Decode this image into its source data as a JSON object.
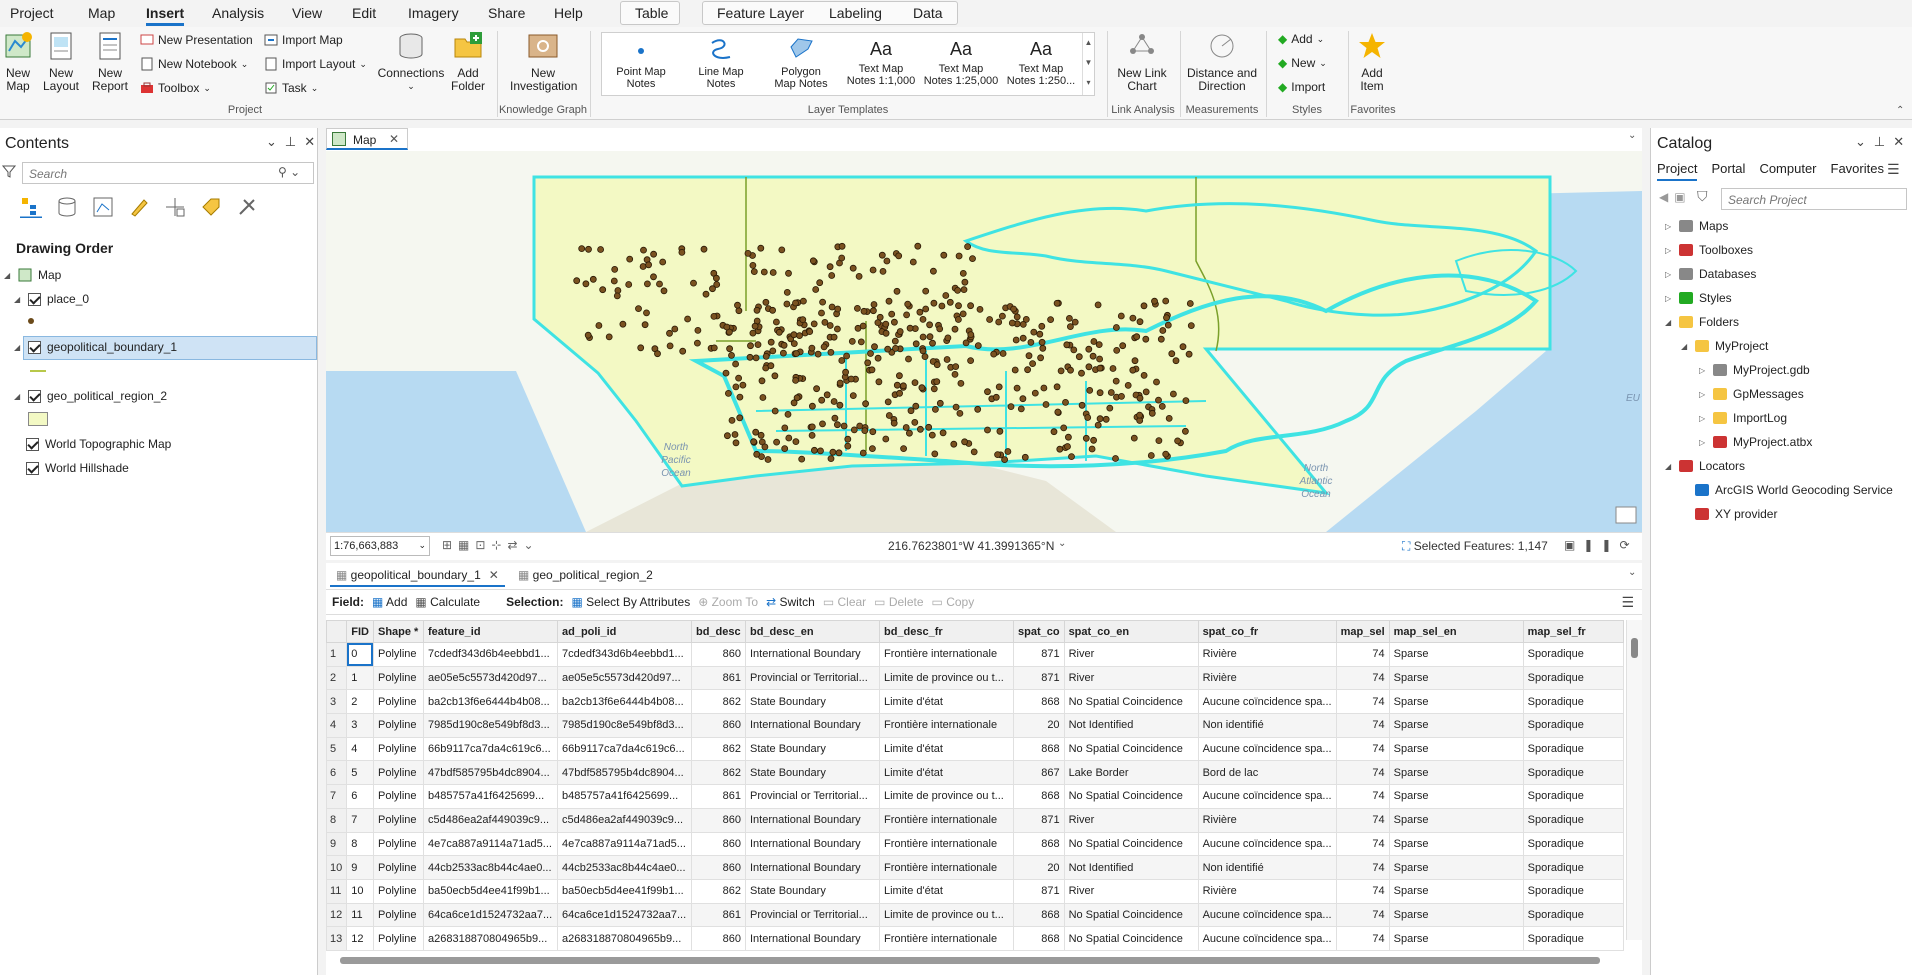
{
  "menu": {
    "tabs": [
      "Project",
      "Map",
      "Insert",
      "Analysis",
      "View",
      "Edit",
      "Imagery",
      "Share",
      "Help"
    ],
    "active": "Insert",
    "context_tabs": [
      "Table",
      "Feature Layer",
      "Labeling",
      "Data"
    ]
  },
  "ribbon": {
    "new_map": "New Map",
    "new_layout": "New Layout",
    "new_report": "New Report",
    "new_presentation": "New Presentation",
    "new_notebook": "New Notebook",
    "toolbox": "Toolbox",
    "import_map": "Import Map",
    "import_layout": "Import Layout",
    "task": "Task",
    "connections": "Connections",
    "add_folder": "Add Folder",
    "group_project": "Project",
    "new_investigation": "New Investigation",
    "group_kg": "Knowledge Graph",
    "templates": [
      {
        "l1": "Point Map",
        "l2": "Notes"
      },
      {
        "l1": "Line Map",
        "l2": "Notes"
      },
      {
        "l1": "Polygon",
        "l2": "Map Notes"
      },
      {
        "l1": "Text Map",
        "l2": "Notes 1:1,000"
      },
      {
        "l1": "Text Map",
        "l2": "Notes 1:25,000"
      },
      {
        "l1": "Text Map",
        "l2": "Notes 1:250..."
      }
    ],
    "group_templates": "Layer Templates",
    "new_link_chart": "New Link Chart",
    "group_link": "Link Analysis",
    "distance_direction": "Distance and Direction",
    "group_measure": "Measurements",
    "styles_add": "Add",
    "styles_new": "New",
    "styles_import": "Import",
    "group_styles": "Styles",
    "add_item": "Add Item",
    "group_fav": "Favorites"
  },
  "contents": {
    "title": "Contents",
    "search_placeholder": "Search",
    "drawing_order": "Drawing Order",
    "map": "Map",
    "layers": [
      "place_0",
      "geopolitical_boundary_1",
      "geo_political_region_2",
      "World Topographic Map",
      "World Hillshade"
    ]
  },
  "map_view": {
    "tab": "Map",
    "scale": "1:76,663,883",
    "coords": "216.7623801°W 41.3991365°N",
    "selected": "Selected Features: 1,147",
    "ocean_pacific": [
      "North",
      "Pacific",
      "Ocean"
    ],
    "ocean_atlantic": [
      "North",
      "Atlantic",
      "Ocean"
    ],
    "edge_label": "EU"
  },
  "catalog": {
    "title": "Catalog",
    "tabs": [
      "Project",
      "Portal",
      "Computer",
      "Favorites"
    ],
    "search_placeholder": "Search Project",
    "items": [
      "Maps",
      "Toolboxes",
      "Databases",
      "Styles",
      "Folders",
      "MyProject",
      "MyProject.gdb",
      "GpMessages",
      "ImportLog",
      "MyProject.atbx",
      "Locators",
      "ArcGIS World Geocoding Service",
      "XY provider"
    ]
  },
  "attr_table": {
    "tabs": [
      "geopolitical_boundary_1",
      "geo_political_region_2"
    ],
    "field_label": "Field:",
    "add": "Add",
    "calculate": "Calculate",
    "selection_label": "Selection:",
    "select_by_attr": "Select By Attributes",
    "zoom_to": "Zoom To",
    "switch": "Switch",
    "clear": "Clear",
    "delete": "Delete",
    "copy": "Copy",
    "columns": [
      "FID",
      "Shape *",
      "feature_id",
      "ad_poli_id",
      "bd_desc",
      "bd_desc_en",
      "bd_desc_fr",
      "spat_co",
      "spat_co_en",
      "spat_co_fr",
      "map_sel",
      "map_sel_en",
      "map_sel_fr"
    ],
    "rows": [
      [
        "1",
        "0",
        "Polyline",
        "7cdedf343d6b4eebbd1...",
        "7cdedf343d6b4eebbd1...",
        "860",
        "International Boundary",
        "Frontière internationale",
        "871",
        "River",
        "Rivière",
        "74",
        "Sparse",
        "Sporadique"
      ],
      [
        "2",
        "1",
        "Polyline",
        "ae05e5c5573d420d97...",
        "ae05e5c5573d420d97...",
        "861",
        "Provincial or Territorial...",
        "Limite de province ou t...",
        "871",
        "River",
        "Rivière",
        "74",
        "Sparse",
        "Sporadique"
      ],
      [
        "3",
        "2",
        "Polyline",
        "ba2cb13f6e6444b4b08...",
        "ba2cb13f6e6444b4b08...",
        "862",
        "State Boundary",
        "Limite d'état",
        "868",
        "No Spatial Coincidence",
        "Aucune coïncidence spa...",
        "74",
        "Sparse",
        "Sporadique"
      ],
      [
        "4",
        "3",
        "Polyline",
        "7985d190c8e549bf8d3...",
        "7985d190c8e549bf8d3...",
        "860",
        "International Boundary",
        "Frontière internationale",
        "20",
        "Not Identified",
        "Non identifié",
        "74",
        "Sparse",
        "Sporadique"
      ],
      [
        "5",
        "4",
        "Polyline",
        "66b9117ca7da4c619c6...",
        "66b9117ca7da4c619c6...",
        "862",
        "State Boundary",
        "Limite d'état",
        "868",
        "No Spatial Coincidence",
        "Aucune coïncidence spa...",
        "74",
        "Sparse",
        "Sporadique"
      ],
      [
        "6",
        "5",
        "Polyline",
        "47bdf585795b4dc8904...",
        "47bdf585795b4dc8904...",
        "862",
        "State Boundary",
        "Limite d'état",
        "867",
        "Lake Border",
        "Bord de lac",
        "74",
        "Sparse",
        "Sporadique"
      ],
      [
        "7",
        "6",
        "Polyline",
        "b485757a41f6425699...",
        "b485757a41f6425699...",
        "861",
        "Provincial or Territorial...",
        "Limite de province ou t...",
        "868",
        "No Spatial Coincidence",
        "Aucune coïncidence spa...",
        "74",
        "Sparse",
        "Sporadique"
      ],
      [
        "8",
        "7",
        "Polyline",
        "c5d486ea2af449039c9...",
        "c5d486ea2af449039c9...",
        "860",
        "International Boundary",
        "Frontière internationale",
        "871",
        "River",
        "Rivière",
        "74",
        "Sparse",
        "Sporadique"
      ],
      [
        "9",
        "8",
        "Polyline",
        "4e7ca887a9114a71ad5...",
        "4e7ca887a9114a71ad5...",
        "860",
        "International Boundary",
        "Frontière internationale",
        "868",
        "No Spatial Coincidence",
        "Aucune coïncidence spa...",
        "74",
        "Sparse",
        "Sporadique"
      ],
      [
        "10",
        "9",
        "Polyline",
        "44cb2533ac8b44c4ae0...",
        "44cb2533ac8b44c4ae0...",
        "860",
        "International Boundary",
        "Frontière internationale",
        "20",
        "Not Identified",
        "Non identifié",
        "74",
        "Sparse",
        "Sporadique"
      ],
      [
        "11",
        "10",
        "Polyline",
        "ba50ecb5d4ee41f99b1...",
        "ba50ecb5d4ee41f99b1...",
        "862",
        "State Boundary",
        "Limite d'état",
        "871",
        "River",
        "Rivière",
        "74",
        "Sparse",
        "Sporadique"
      ],
      [
        "12",
        "11",
        "Polyline",
        "64ca6ce1d1524732aa7...",
        "64ca6ce1d1524732aa7...",
        "861",
        "Provincial or Territorial...",
        "Limite de province ou t...",
        "868",
        "No Spatial Coincidence",
        "Aucune coïncidence spa...",
        "74",
        "Sparse",
        "Sporadique"
      ],
      [
        "13",
        "12",
        "Polyline",
        "a268318870804965b9...",
        "a268318870804965b9...",
        "860",
        "International Boundary",
        "Frontière internationale",
        "868",
        "No Spatial Coincidence",
        "Aucune coïncidence spa...",
        "74",
        "Sparse",
        "Sporadique"
      ]
    ]
  },
  "colors": {
    "accent": "#1a73c9",
    "region_fill": "#f3f9c4",
    "boundary": "#3fe3e3",
    "point": "#6b4a1a",
    "water": "#b7daf2"
  }
}
